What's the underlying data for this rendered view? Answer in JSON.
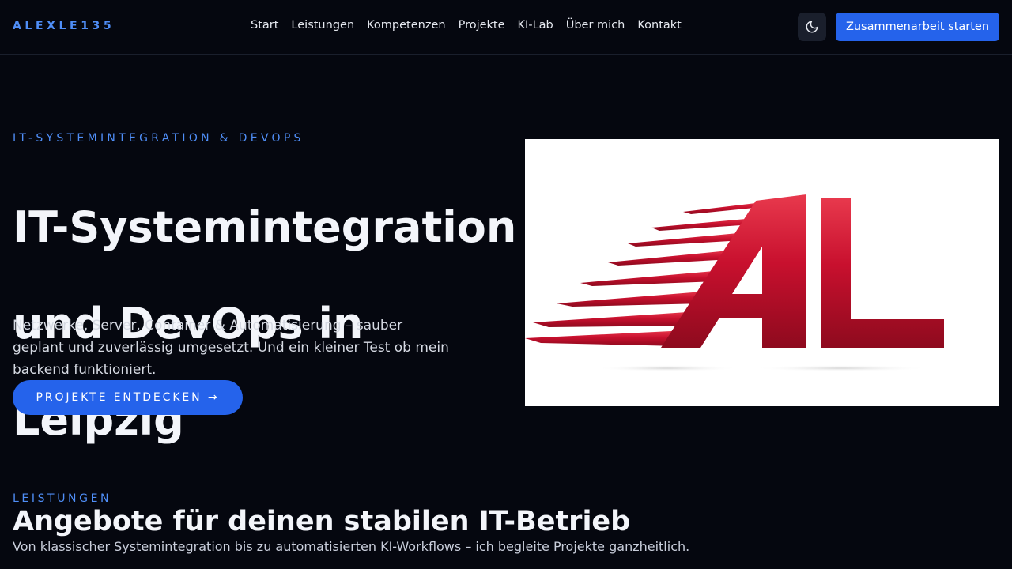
{
  "header": {
    "brand": "ALEXLE135",
    "nav": [
      "Start",
      "Leistungen",
      "Kompetenzen",
      "Projekte",
      "KI-Lab",
      "Über mich",
      "Kontakt"
    ],
    "theme_toggle_icon": "moon-icon",
    "cta_label": "Zusammenarbeit starten"
  },
  "hero": {
    "eyebrow": "IT-SYSTEMINTEGRATION & DEVOPS",
    "title_lines": [
      "IT-Systemintegration",
      "und DevOps in",
      "Leipzig"
    ],
    "text": "Netzwerke, Server, Container & Automatisierung – sauber geplant und zuverlässig umgesetzt. Und ein kleiner Test ob mein backend funktioniert.",
    "button_label": "PROJEKTE ENTDECKEN →",
    "logo": "AL"
  },
  "services": {
    "eyebrow": "LEISTUNGEN",
    "title": "Angebote für deinen stabilen IT-Betrieb",
    "text": "Von klassischer Systemintegration bis zu automatisierten KI-Workflows – ich begleite Projekte ganzheitlich."
  },
  "colors": {
    "background": "#05070f",
    "accent": "#2563eb",
    "eyebrow": "#4f8ef7",
    "logo_red": "#c8102e"
  }
}
